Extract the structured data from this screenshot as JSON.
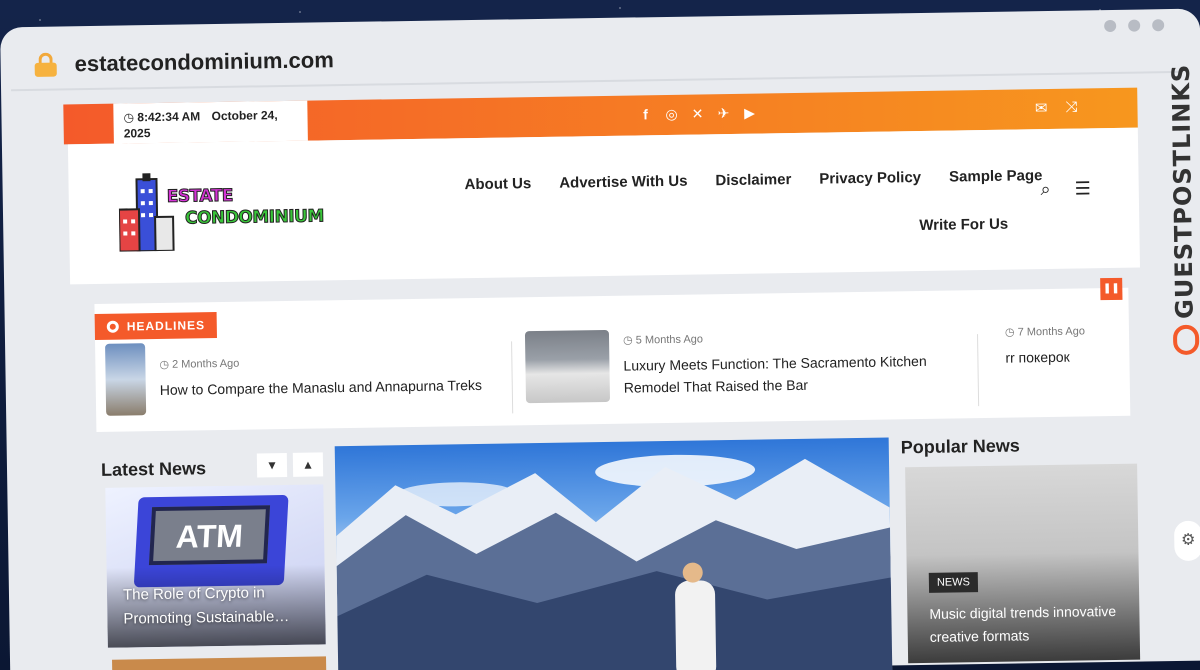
{
  "browser": {
    "url": "estatecondominium.com"
  },
  "topbar": {
    "time": "8:42:34 AM",
    "date": "October 24, 2025",
    "social_icons": [
      "facebook-icon",
      "instagram-icon",
      "x-icon",
      "vk-icon",
      "youtube-icon"
    ],
    "right_icons": [
      "mail-icon",
      "shuffle-icon"
    ],
    "accent": "#f45a2a"
  },
  "header": {
    "logo_line1": "ESTATE",
    "logo_line2": "CONDOMINIUM",
    "nav": [
      "About Us",
      "Advertise With Us",
      "Disclaimer",
      "Privacy Policy",
      "Sample Page",
      "Write For Us"
    ]
  },
  "headlines": {
    "label": "HEADLINES",
    "items": [
      {
        "meta": "2 Months Ago",
        "title": "How to Compare the Manaslu and Annapurna Treks"
      },
      {
        "meta": "5 Months Ago",
        "title": "Luxury Meets Function: The Sacramento Kitchen Remodel That Raised the Bar"
      },
      {
        "meta": "7 Months Ago",
        "title": "rr покерок"
      }
    ]
  },
  "latest": {
    "heading": "Latest News",
    "card_title": "The Role of Crypto in Promoting Sustainable…",
    "card_image_text": "ATM"
  },
  "popular": {
    "heading": "Popular News",
    "badge": "NEWS",
    "card_title": "Music digital trends innovative creative formats"
  },
  "sidebar_badge": {
    "text": "GUESTPOSTLINKS"
  }
}
